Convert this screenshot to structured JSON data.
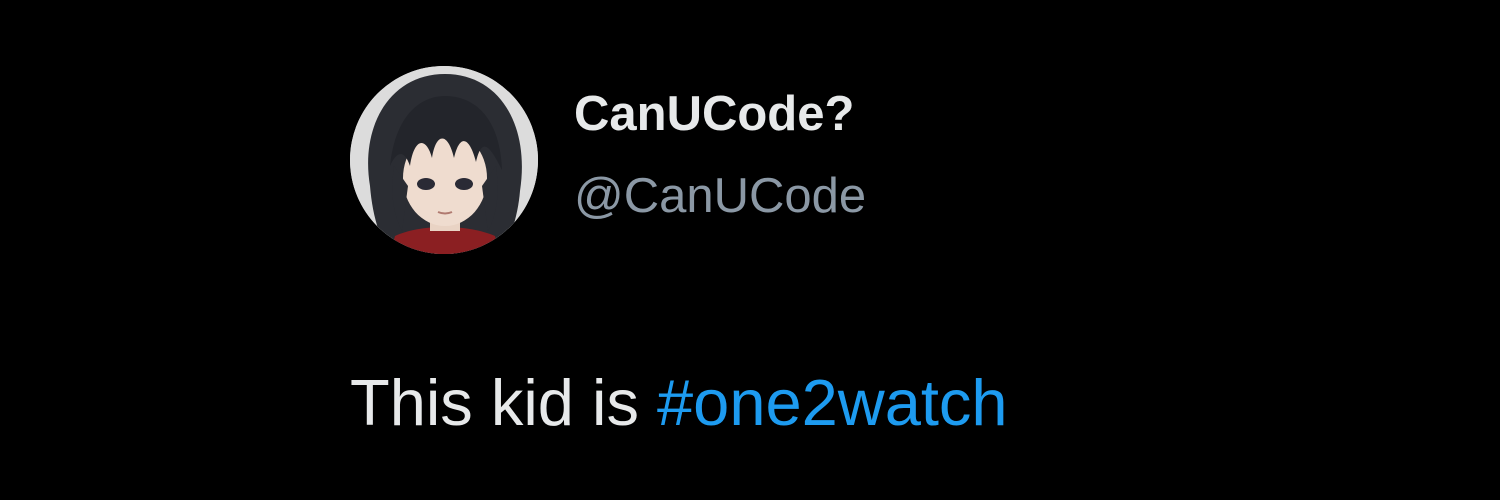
{
  "tweet": {
    "author": {
      "display_name": "CanUCode?",
      "handle": "@CanUCode",
      "avatar_icon": "anime-girl-avatar"
    },
    "text_prefix": "This kid is ",
    "hashtag": "#one2watch"
  },
  "colors": {
    "background": "#000000",
    "display_name": "#e7e9ea",
    "handle": "#8b98a5",
    "text": "#e7e9ea",
    "hashtag": "#1d9bf0"
  }
}
